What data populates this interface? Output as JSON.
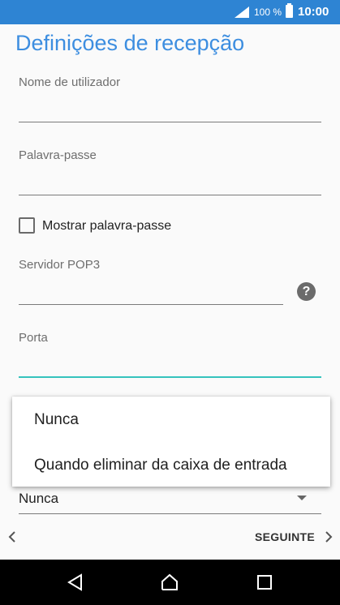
{
  "status_bar": {
    "battery_text": "100 %",
    "time": "10:00",
    "signal_icon": "signal-icon",
    "battery_icon": "battery-icon",
    "background": "#2e84d3"
  },
  "page": {
    "title": "Definições de recepção",
    "title_color": "#3d8ee0"
  },
  "form": {
    "username_label": "Nome de utilizador",
    "password_label": "Palavra-passe",
    "show_password_label": "Mostrar palavra-passe",
    "server_label": "Servidor POP3",
    "port_label": "Porta",
    "help_icon": "help-icon",
    "accent_color": "#35c3bd"
  },
  "dropdown": {
    "options": [
      "Nunca",
      "Quando eliminar da caixa de entrada"
    ],
    "selected": "Nunca"
  },
  "footer": {
    "next_label": "SEGUINTE"
  }
}
